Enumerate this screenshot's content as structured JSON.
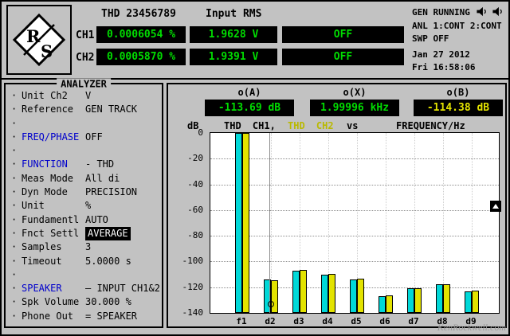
{
  "header": {
    "logo": {
      "r": "R",
      "s": "S"
    },
    "thd": {
      "title": "THD 23456789",
      "ch1_label": "CH1",
      "ch1_value": "0.0006054 %",
      "ch2_label": "CH2",
      "ch2_value": "0.0005870 %"
    },
    "input_rms": {
      "title": "Input RMS",
      "ch1_value": "1.9628 V",
      "ch2_value": "1.9391 V"
    },
    "aux": {
      "row1": "OFF",
      "row2": "OFF"
    },
    "status": {
      "gen": "GEN RUNNING",
      "icons": [
        "speaker-icon",
        "speaker-icon"
      ],
      "anl": "ANL 1:CONT 2:CONT",
      "swp": "SWP OFF",
      "date": "Jan 27 2012",
      "time": "Fri 16:58:06"
    }
  },
  "menu": {
    "title": "ANALYZER",
    "items": [
      {
        "label": "Unit Ch2",
        "value": "V"
      },
      {
        "label": "Reference",
        "value": "GEN TRACK"
      },
      {
        "spacer": true
      },
      {
        "label": "FREQ/PHASE",
        "value": "OFF",
        "label_color": "blue"
      },
      {
        "spacer": true
      },
      {
        "label": "FUNCTION",
        "value": "- THD",
        "label_color": "blue"
      },
      {
        "label": "Meas Mode",
        "value": "All di"
      },
      {
        "label": "Dyn Mode",
        "value": "PRECISION"
      },
      {
        "label": "Unit",
        "value": "%"
      },
      {
        "label": "Fundamentl",
        "value": "AUTO"
      },
      {
        "label": "Fnct Settl",
        "value": "AVERAGE",
        "selected": true
      },
      {
        "label": "Samples",
        "value": "3"
      },
      {
        "label": "Timeout",
        "value": "5.0000 s"
      },
      {
        "spacer": true
      },
      {
        "label": "SPEAKER",
        "value": "— INPUT CH1&2",
        "label_color": "blue"
      },
      {
        "label": "Spk Volume",
        "value": "30.000 %"
      },
      {
        "label": "Phone Out",
        "value": "= SPEAKER"
      }
    ]
  },
  "chart": {
    "cursors": [
      {
        "name": "o(A)",
        "value": "-113.69 dB",
        "color": "#00dc00"
      },
      {
        "name": "o(X)",
        "value": "1.99996 kHz",
        "color": "#00dc00"
      },
      {
        "name": "o(B)",
        "value": "-114.38 dB",
        "color": "#e3e300"
      }
    ],
    "legend": {
      "db": "dB",
      "trace1": "THD CH1,",
      "trace2": "THD CH2",
      "vs": "vs",
      "xlabel": "FREQUENCY/Hz"
    }
  },
  "chart_data": {
    "type": "bar",
    "title": "THD CH1, THD CH2 vs FREQUENCY/Hz",
    "categories": [
      "f1",
      "d2",
      "d3",
      "d4",
      "d5",
      "d6",
      "d7",
      "d8",
      "d9"
    ],
    "series": [
      {
        "name": "THD CH1",
        "color": "#00d8d8",
        "values": [
          0,
          -113.69,
          -107,
          -110,
          -114,
          -127,
          -121,
          -118,
          -123
        ]
      },
      {
        "name": "THD CH2",
        "color": "#e3e300",
        "values": [
          0,
          -114.38,
          -106.5,
          -109.5,
          -113.5,
          -126.5,
          -120.5,
          -117.5,
          -122.5
        ]
      }
    ],
    "ylabel": "dB",
    "xlabel": "FREQUENCY/Hz",
    "ylim": [
      -140,
      0
    ],
    "yticks": [
      0,
      -20,
      -40,
      -60,
      -80,
      -100,
      -120,
      -140
    ],
    "grid": true,
    "legend_position": "top",
    "cursor": {
      "category": "d2",
      "x_value": "1.99996 kHz",
      "a_value_db": -113.69,
      "b_value_db": -114.38,
      "marker_db": -133
    }
  },
  "watermark": "KenRockwell.com",
  "colors": {
    "background": "#c2c2c2",
    "lcd_green": "#00dc00",
    "lcd_yellow": "#e3e300",
    "trace_ch1_cyan": "#00d8d8",
    "trace_ch2_yellow": "#e3e300",
    "menu_blue": "#0000cc"
  }
}
